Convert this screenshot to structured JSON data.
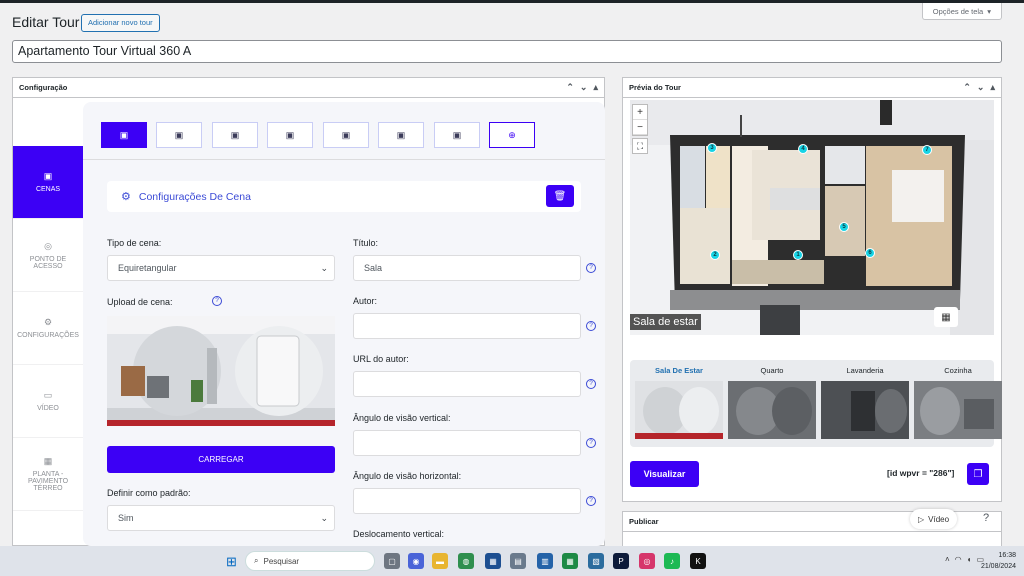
{
  "header": {
    "page_title": "Editar Tour",
    "add_new_label": "Adicionar novo tour",
    "screen_options_label": "Opções de tela",
    "tour_title": "Apartamento Tour Virtual 360 A"
  },
  "config_panel": {
    "title": "Configuração",
    "tabs": [
      {
        "label": "CENAS",
        "icon": "image-icon",
        "active": true
      },
      {
        "label": "PONTO DE ACESSO",
        "icon": "target-icon"
      },
      {
        "label": "CONFIGURAÇÕES",
        "icon": "gear-icon"
      },
      {
        "label": "VÍDEO",
        "icon": "video-icon"
      },
      {
        "label": "PLANTA - PAVIMENTO TÉRREO",
        "icon": "map-icon"
      }
    ],
    "scene_settings_title": "Configurações De Cena",
    "scene_type_label": "Tipo de cena:",
    "scene_type_value": "Equiretangular",
    "upload_label": "Upload de cena:",
    "upload_button": "CARREGAR",
    "default_label": "Definir como padrão:",
    "default_value": "Sim",
    "title_label": "Título:",
    "title_value": "Sala",
    "author_label": "Autor:",
    "author_url_label": "URL do autor:",
    "vfov_label": "Ângulo de visão vertical:",
    "hfov_label": "Ângulo de visão horizontal:",
    "voffset_label": "Deslocamento vertical:"
  },
  "preview_panel": {
    "title": "Prévia do Tour",
    "scene_caption": "Sala de estar",
    "hotspots": [
      "1",
      "2",
      "3",
      "4",
      "5",
      "6",
      "7"
    ],
    "thumbnails": [
      {
        "label": "Sala De Estar",
        "active": true
      },
      {
        "label": "Quarto"
      },
      {
        "label": "Lavanderia"
      },
      {
        "label": "Cozinha"
      }
    ],
    "view_button": "Visualizar",
    "shortcode": "[id wpvr = \"286\"]"
  },
  "publish_panel": {
    "title": "Publicar"
  },
  "floating": {
    "video_label": "Vídeo",
    "help_label": "?"
  },
  "taskbar": {
    "search_placeholder": "Pesquisar",
    "time": "16:38",
    "date": "21/08/2024"
  },
  "colors": {
    "accent": "#3c00f5",
    "link": "#3c4bd6",
    "wp_blue": "#2271b1"
  }
}
